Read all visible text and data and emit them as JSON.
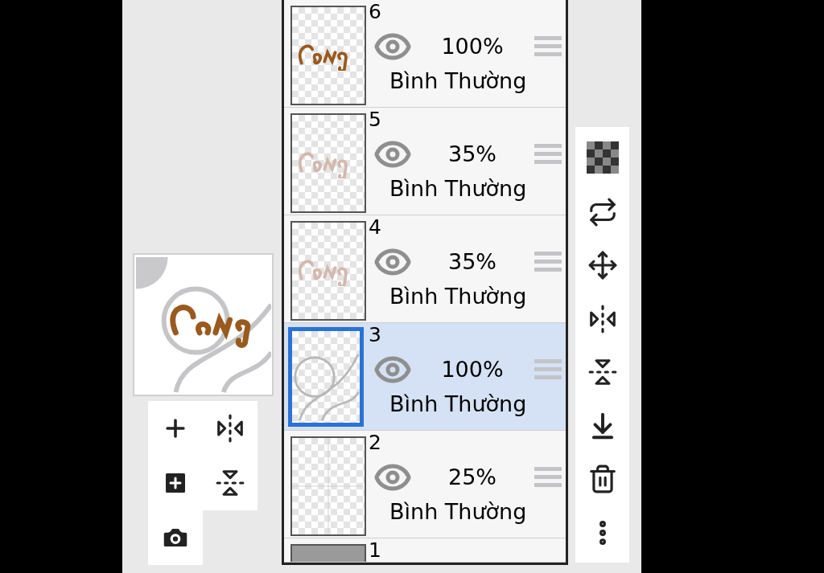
{
  "layers": [
    {
      "number": "6",
      "opacity": "100%",
      "blend_mode": "Bình Thường",
      "visible": true,
      "selected": false
    },
    {
      "number": "5",
      "opacity": "35%",
      "blend_mode": "Bình Thường",
      "visible": true,
      "selected": false
    },
    {
      "number": "4",
      "opacity": "35%",
      "blend_mode": "Bình Thường",
      "visible": true,
      "selected": false
    },
    {
      "number": "3",
      "opacity": "100%",
      "blend_mode": "Bình Thường",
      "visible": true,
      "selected": true
    },
    {
      "number": "2",
      "opacity": "25%",
      "blend_mode": "Bình Thường",
      "visible": true,
      "selected": false
    },
    {
      "number": "1",
      "selected": false
    }
  ]
}
